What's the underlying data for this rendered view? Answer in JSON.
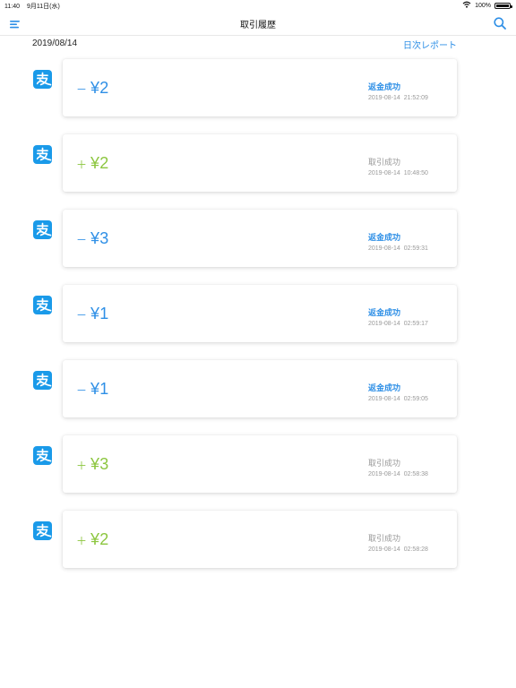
{
  "status_bar": {
    "time": "11:40",
    "date": "9月11日(水)",
    "battery": "100%",
    "battery_level": 1.0,
    "wifi_icon": "wifi-icon"
  },
  "nav": {
    "title": "取引履歴",
    "menu_icon": "menu-icon",
    "search_icon": "search-icon"
  },
  "date_header": {
    "date": "2019/08/14",
    "report_link": "日次レポート"
  },
  "colors": {
    "refund": "#2e8fe6",
    "deal": "#8cc63f",
    "muted": "#999999",
    "alipay": "#1a9ae9"
  },
  "transactions": [
    {
      "sign": "－",
      "amount": "¥2",
      "status": "返金成功",
      "time": "2019-08-14  21:52:09",
      "kind": "refund",
      "icon": "alipay-icon"
    },
    {
      "sign": "＋",
      "amount": "¥2",
      "status": "取引成功",
      "time": "2019-08-14  10:48:50",
      "kind": "deal",
      "icon": "alipay-icon"
    },
    {
      "sign": "－",
      "amount": "¥3",
      "status": "返金成功",
      "time": "2019-08-14  02:59:31",
      "kind": "refund",
      "icon": "alipay-icon"
    },
    {
      "sign": "－",
      "amount": "¥1",
      "status": "返金成功",
      "time": "2019-08-14  02:59:17",
      "kind": "refund",
      "icon": "alipay-icon"
    },
    {
      "sign": "－",
      "amount": "¥1",
      "status": "返金成功",
      "time": "2019-08-14  02:59:05",
      "kind": "refund",
      "icon": "alipay-icon"
    },
    {
      "sign": "＋",
      "amount": "¥3",
      "status": "取引成功",
      "time": "2019-08-14  02:58:38",
      "kind": "deal",
      "icon": "alipay-icon"
    },
    {
      "sign": "＋",
      "amount": "¥2",
      "status": "取引成功",
      "time": "2019-08-14  02:58:28",
      "kind": "deal",
      "icon": "alipay-icon"
    }
  ]
}
